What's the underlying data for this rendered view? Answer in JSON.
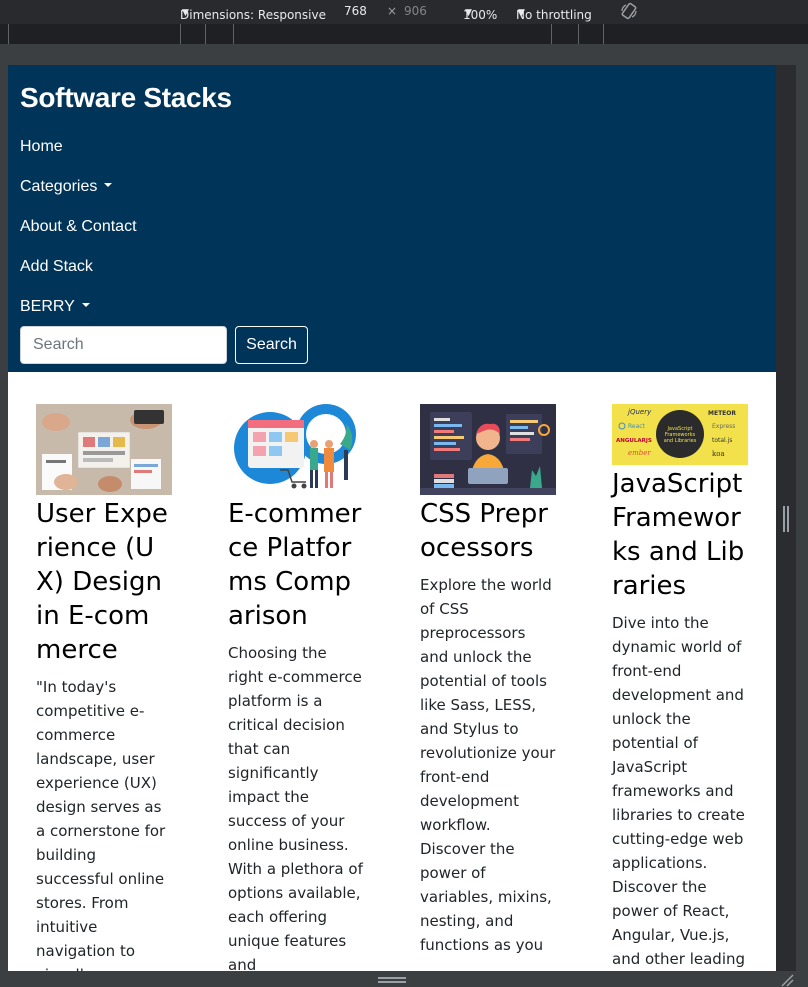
{
  "devtools": {
    "dimensions_label": "Dimensions: Responsive",
    "width": "768",
    "times": "×",
    "height": "906",
    "zoom": "100%",
    "throttling": "No throttling"
  },
  "navbar": {
    "brand": "Software Stacks",
    "items": {
      "home": "Home",
      "categories": "Categories",
      "about": "About & Contact",
      "add_stack": "Add Stack",
      "user": "BERRY"
    },
    "search": {
      "placeholder": "Search",
      "button": "Search"
    }
  },
  "cards": [
    {
      "title": "User Experience (UX) Design in E-commerce",
      "text": "\"In today's competitive e-commerce landscape, user experience (UX) design serves as a cornerstone for building successful online stores. From intuitive navigation to visually"
    },
    {
      "title": "E-commerce Platforms Comparison",
      "text": "Choosing the right e-commerce platform is a critical decision that can significantly impact the success of your online business. With a plethora of options available, each offering unique features and functionalities"
    },
    {
      "title": "CSS Preprocessors",
      "text": "Explore the world of CSS preprocessors and unlock the potential of tools like Sass, LESS, and Stylus to revolutionize your front-end development workflow. Discover the power of variables, mixins, nesting, and functions as you"
    },
    {
      "title": "JavaScript Frameworks and Libraries",
      "text": "Dive into the dynamic world of front-end development and unlock the potential of JavaScript frameworks and libraries to create cutting-edge web applications. Discover the power of React, Angular, Vue.js, and other leading"
    }
  ],
  "card4_image": {
    "center": "JavaScript Frameworks and Libraries",
    "logos": [
      "jQuery",
      "METEOR",
      "React",
      "Express",
      "ANGULARJS",
      "total.js",
      "ember",
      "koa"
    ]
  },
  "colors": {
    "navbar": "#003459",
    "card4_bg": "#f2e14a"
  }
}
